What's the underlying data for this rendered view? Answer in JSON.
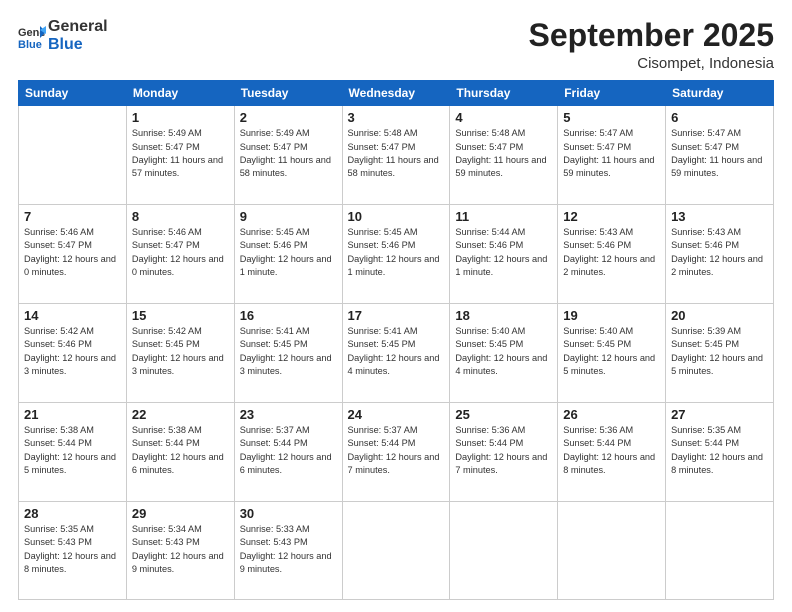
{
  "header": {
    "logo_general": "General",
    "logo_blue": "Blue",
    "month_title": "September 2025",
    "location": "Cisompet, Indonesia"
  },
  "weekdays": [
    "Sunday",
    "Monday",
    "Tuesday",
    "Wednesday",
    "Thursday",
    "Friday",
    "Saturday"
  ],
  "weeks": [
    [
      {
        "day": "",
        "empty": true
      },
      {
        "day": "1",
        "sunrise": "Sunrise: 5:49 AM",
        "sunset": "Sunset: 5:47 PM",
        "daylight": "Daylight: 11 hours and 57 minutes."
      },
      {
        "day": "2",
        "sunrise": "Sunrise: 5:49 AM",
        "sunset": "Sunset: 5:47 PM",
        "daylight": "Daylight: 11 hours and 58 minutes."
      },
      {
        "day": "3",
        "sunrise": "Sunrise: 5:48 AM",
        "sunset": "Sunset: 5:47 PM",
        "daylight": "Daylight: 11 hours and 58 minutes."
      },
      {
        "day": "4",
        "sunrise": "Sunrise: 5:48 AM",
        "sunset": "Sunset: 5:47 PM",
        "daylight": "Daylight: 11 hours and 59 minutes."
      },
      {
        "day": "5",
        "sunrise": "Sunrise: 5:47 AM",
        "sunset": "Sunset: 5:47 PM",
        "daylight": "Daylight: 11 hours and 59 minutes."
      },
      {
        "day": "6",
        "sunrise": "Sunrise: 5:47 AM",
        "sunset": "Sunset: 5:47 PM",
        "daylight": "Daylight: 11 hours and 59 minutes."
      }
    ],
    [
      {
        "day": "7",
        "sunrise": "Sunrise: 5:46 AM",
        "sunset": "Sunset: 5:47 PM",
        "daylight": "Daylight: 12 hours and 0 minutes."
      },
      {
        "day": "8",
        "sunrise": "Sunrise: 5:46 AM",
        "sunset": "Sunset: 5:47 PM",
        "daylight": "Daylight: 12 hours and 0 minutes."
      },
      {
        "day": "9",
        "sunrise": "Sunrise: 5:45 AM",
        "sunset": "Sunset: 5:46 PM",
        "daylight": "Daylight: 12 hours and 1 minute."
      },
      {
        "day": "10",
        "sunrise": "Sunrise: 5:45 AM",
        "sunset": "Sunset: 5:46 PM",
        "daylight": "Daylight: 12 hours and 1 minute."
      },
      {
        "day": "11",
        "sunrise": "Sunrise: 5:44 AM",
        "sunset": "Sunset: 5:46 PM",
        "daylight": "Daylight: 12 hours and 1 minute."
      },
      {
        "day": "12",
        "sunrise": "Sunrise: 5:43 AM",
        "sunset": "Sunset: 5:46 PM",
        "daylight": "Daylight: 12 hours and 2 minutes."
      },
      {
        "day": "13",
        "sunrise": "Sunrise: 5:43 AM",
        "sunset": "Sunset: 5:46 PM",
        "daylight": "Daylight: 12 hours and 2 minutes."
      }
    ],
    [
      {
        "day": "14",
        "sunrise": "Sunrise: 5:42 AM",
        "sunset": "Sunset: 5:46 PM",
        "daylight": "Daylight: 12 hours and 3 minutes."
      },
      {
        "day": "15",
        "sunrise": "Sunrise: 5:42 AM",
        "sunset": "Sunset: 5:45 PM",
        "daylight": "Daylight: 12 hours and 3 minutes."
      },
      {
        "day": "16",
        "sunrise": "Sunrise: 5:41 AM",
        "sunset": "Sunset: 5:45 PM",
        "daylight": "Daylight: 12 hours and 3 minutes."
      },
      {
        "day": "17",
        "sunrise": "Sunrise: 5:41 AM",
        "sunset": "Sunset: 5:45 PM",
        "daylight": "Daylight: 12 hours and 4 minutes."
      },
      {
        "day": "18",
        "sunrise": "Sunrise: 5:40 AM",
        "sunset": "Sunset: 5:45 PM",
        "daylight": "Daylight: 12 hours and 4 minutes."
      },
      {
        "day": "19",
        "sunrise": "Sunrise: 5:40 AM",
        "sunset": "Sunset: 5:45 PM",
        "daylight": "Daylight: 12 hours and 5 minutes."
      },
      {
        "day": "20",
        "sunrise": "Sunrise: 5:39 AM",
        "sunset": "Sunset: 5:45 PM",
        "daylight": "Daylight: 12 hours and 5 minutes."
      }
    ],
    [
      {
        "day": "21",
        "sunrise": "Sunrise: 5:38 AM",
        "sunset": "Sunset: 5:44 PM",
        "daylight": "Daylight: 12 hours and 5 minutes."
      },
      {
        "day": "22",
        "sunrise": "Sunrise: 5:38 AM",
        "sunset": "Sunset: 5:44 PM",
        "daylight": "Daylight: 12 hours and 6 minutes."
      },
      {
        "day": "23",
        "sunrise": "Sunrise: 5:37 AM",
        "sunset": "Sunset: 5:44 PM",
        "daylight": "Daylight: 12 hours and 6 minutes."
      },
      {
        "day": "24",
        "sunrise": "Sunrise: 5:37 AM",
        "sunset": "Sunset: 5:44 PM",
        "daylight": "Daylight: 12 hours and 7 minutes."
      },
      {
        "day": "25",
        "sunrise": "Sunrise: 5:36 AM",
        "sunset": "Sunset: 5:44 PM",
        "daylight": "Daylight: 12 hours and 7 minutes."
      },
      {
        "day": "26",
        "sunrise": "Sunrise: 5:36 AM",
        "sunset": "Sunset: 5:44 PM",
        "daylight": "Daylight: 12 hours and 8 minutes."
      },
      {
        "day": "27",
        "sunrise": "Sunrise: 5:35 AM",
        "sunset": "Sunset: 5:44 PM",
        "daylight": "Daylight: 12 hours and 8 minutes."
      }
    ],
    [
      {
        "day": "28",
        "sunrise": "Sunrise: 5:35 AM",
        "sunset": "Sunset: 5:43 PM",
        "daylight": "Daylight: 12 hours and 8 minutes."
      },
      {
        "day": "29",
        "sunrise": "Sunrise: 5:34 AM",
        "sunset": "Sunset: 5:43 PM",
        "daylight": "Daylight: 12 hours and 9 minutes."
      },
      {
        "day": "30",
        "sunrise": "Sunrise: 5:33 AM",
        "sunset": "Sunset: 5:43 PM",
        "daylight": "Daylight: 12 hours and 9 minutes."
      },
      {
        "day": "",
        "empty": true
      },
      {
        "day": "",
        "empty": true
      },
      {
        "day": "",
        "empty": true
      },
      {
        "day": "",
        "empty": true
      }
    ]
  ]
}
